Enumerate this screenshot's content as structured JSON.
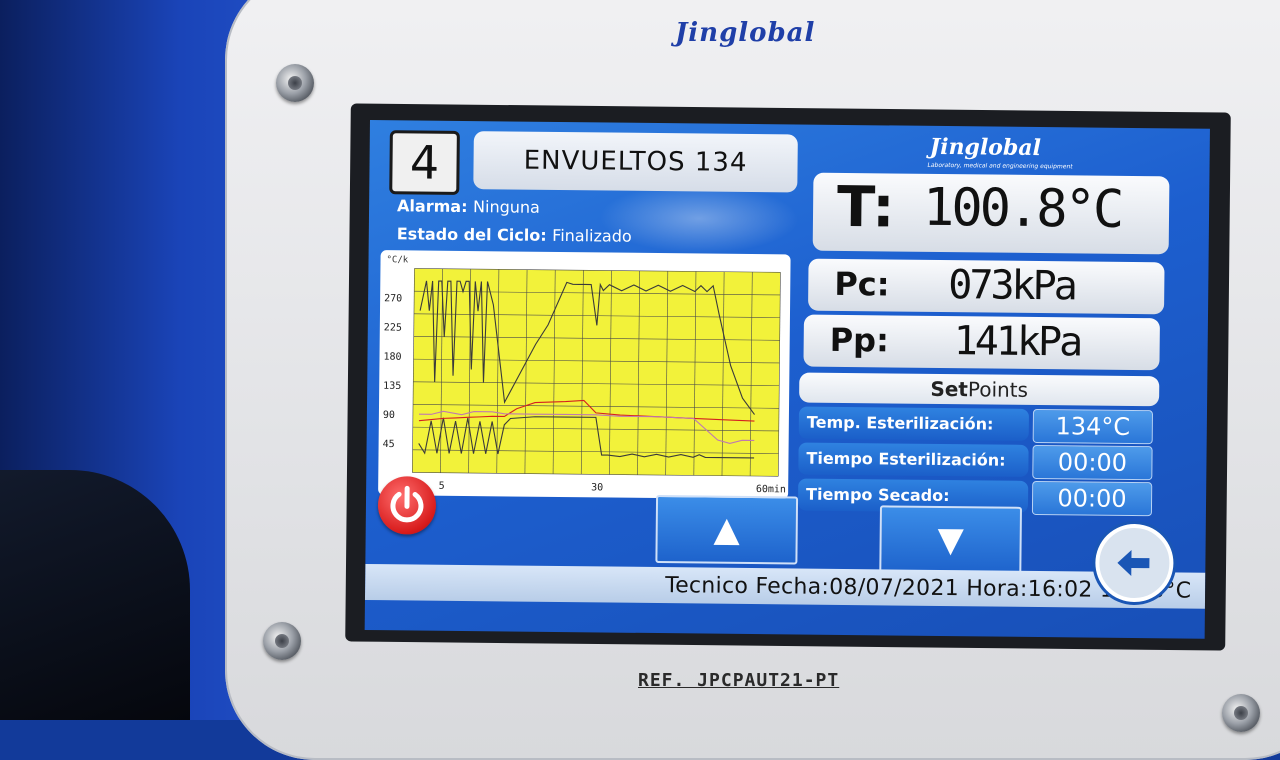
{
  "device": {
    "brand": "Jinglobal",
    "model_ref": "REF. JPCPAUT21-PT"
  },
  "screen": {
    "program_number": "4",
    "program_name": "ENVUELTOS 134",
    "alarm_label": "Alarma:",
    "alarm_value": "Ninguna",
    "cycle_label": "Estado del Ciclo:",
    "cycle_value": "Finalizado",
    "logo_text": "Jinglobal",
    "logo_subtext": "Laboratory, medical and engineering equipment",
    "temperature": {
      "label": "T:",
      "value": "100.8°C"
    },
    "chamber_pressure": {
      "label": "Pc:",
      "value": "073kPa"
    },
    "jacket_pressure": {
      "label": "Pp:",
      "value": "141kPa"
    },
    "setpoints_bold": "Set",
    "setpoints_rest": "Points",
    "setpoints": [
      {
        "label": "Temp. Esterilización:",
        "value": "134°C"
      },
      {
        "label": "Tiempo Esterilización:",
        "value": "00:00"
      },
      {
        "label": "Tiempo Secado:",
        "value": "00:00"
      }
    ],
    "footer": "Tecnico Fecha:08/07/2021  Hora:16:02 134.8°C",
    "up_button": "▲",
    "down_button": "▼",
    "power_icon": "power-icon",
    "back_icon": "back-arrow-icon"
  },
  "chart_data": {
    "type": "line",
    "y_unit_label": "°C/k",
    "x_unit_label": "min",
    "y_ticks": [
      "270",
      "225",
      "180",
      "135",
      "90",
      "45"
    ],
    "x_ticks": [
      "5",
      "30",
      "60min"
    ],
    "ylim": [
      0,
      315
    ],
    "xlim": [
      0,
      60
    ],
    "grid": true,
    "background": "#f2f23a",
    "series": [
      {
        "color": "#3a3a3a",
        "x": [
          1,
          2,
          2.5,
          3,
          3.5,
          4,
          4.5,
          5,
          5.5,
          6,
          6.5,
          7,
          7.5,
          8,
          8.5,
          9,
          9.5,
          10,
          10.5,
          11,
          11.5,
          12,
          13,
          15,
          20,
          22,
          25,
          26,
          27,
          28,
          29,
          30,
          30.5,
          31,
          32,
          34,
          36,
          38,
          40,
          42,
          44,
          46,
          47,
          48,
          49,
          50,
          52,
          54,
          56
        ],
        "y": [
          250,
          296,
          250,
          296,
          140,
          296,
          296,
          210,
          296,
          296,
          150,
          296,
          296,
          280,
          296,
          296,
          160,
          296,
          250,
          296,
          140,
          296,
          260,
          110,
          200,
          230,
          296,
          293,
          293,
          293,
          293,
          230,
          293,
          284,
          293,
          284,
          293,
          284,
          293,
          284,
          293,
          284,
          293,
          284,
          293,
          250,
          170,
          120,
          95
        ]
      },
      {
        "color": "#3a3a3a",
        "x": [
          1,
          2,
          3,
          4,
          5,
          6,
          7,
          8,
          9,
          10,
          11,
          12,
          13,
          14,
          15,
          16,
          20,
          25,
          30,
          31,
          32,
          34,
          36,
          38,
          40,
          42,
          44,
          46,
          47,
          48,
          50,
          52,
          54,
          56
        ],
        "y": [
          45,
          30,
          80,
          30,
          85,
          30,
          80,
          30,
          85,
          30,
          80,
          30,
          80,
          30,
          75,
          85,
          88,
          88,
          88,
          30,
          30,
          28,
          32,
          28,
          32,
          28,
          32,
          28,
          32,
          28,
          28,
          28,
          28,
          28
        ]
      },
      {
        "color": "#d42020",
        "x": [
          1,
          3,
          5,
          7,
          9,
          11,
          13,
          15,
          17,
          20,
          25,
          28,
          30,
          34,
          40,
          46,
          52,
          56
        ],
        "y": [
          80,
          82,
          84,
          85,
          86,
          87,
          88,
          88,
          100,
          110,
          112,
          114,
          95,
          92,
          90,
          88,
          86,
          85
        ]
      },
      {
        "color": "#c07ab0",
        "x": [
          1,
          3,
          5,
          8,
          10,
          13,
          15,
          20,
          25,
          30,
          34,
          40,
          46,
          50,
          52,
          54,
          56
        ],
        "y": [
          90,
          90,
          95,
          90,
          95,
          95,
          92,
          92,
          92,
          92,
          90,
          90,
          88,
          55,
          50,
          55,
          55
        ]
      }
    ]
  }
}
